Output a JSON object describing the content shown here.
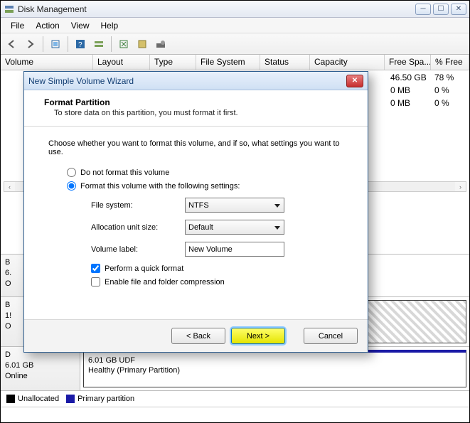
{
  "window": {
    "title": "Disk Management",
    "menus": [
      "File",
      "Action",
      "View",
      "Help"
    ]
  },
  "columns": {
    "volume": "Volume",
    "layout": "Layout",
    "type": "Type",
    "fs": "File System",
    "status": "Status",
    "capacity": "Capacity",
    "freespace": "Free Spa...",
    "pctfree": "% Free"
  },
  "rows": [
    {
      "free": "46.50 GB",
      "pct": "78 %"
    },
    {
      "free": "0 MB",
      "pct": "0 %"
    },
    {
      "free": "0 MB",
      "pct": "0 %"
    }
  ],
  "diskPane": {
    "d_label": "D",
    "d_size": "6.01 GB",
    "d_status": "Online",
    "part_size": "6.01 GB UDF",
    "part_status": "Healthy (Primary Partition)",
    "b1": "B",
    "b1_size": "6.",
    "b1_status": "O",
    "b2": "B",
    "b2_size": "1!",
    "b2_status": "O"
  },
  "legend": {
    "unallocated": "Unallocated",
    "primary": "Primary partition",
    "color_unalloc": "#000000",
    "color_primary": "#1a1aa6"
  },
  "wizard": {
    "title": "New Simple Volume Wizard",
    "heading": "Format Partition",
    "subheading": "To store data on this partition, you must format it first.",
    "intro": "Choose whether you want to format this volume, and if so, what settings you want to use.",
    "opt_noformat": "Do not format this volume",
    "opt_format": "Format this volume with the following settings:",
    "lbl_fs": "File system:",
    "val_fs": "NTFS",
    "lbl_au": "Allocation unit size:",
    "val_au": "Default",
    "lbl_vl": "Volume label:",
    "val_vl": "New Volume",
    "chk_quick": "Perform a quick format",
    "chk_compress": "Enable file and folder compression",
    "btn_back": "< Back",
    "btn_next": "Next >",
    "btn_cancel": "Cancel"
  }
}
